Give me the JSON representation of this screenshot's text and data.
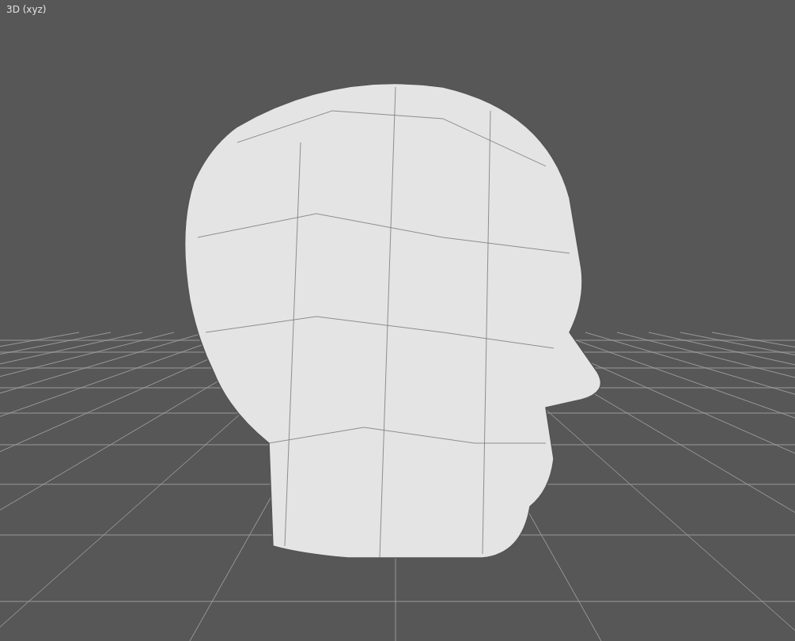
{
  "viewport": {
    "label": "3D (xyz)"
  }
}
